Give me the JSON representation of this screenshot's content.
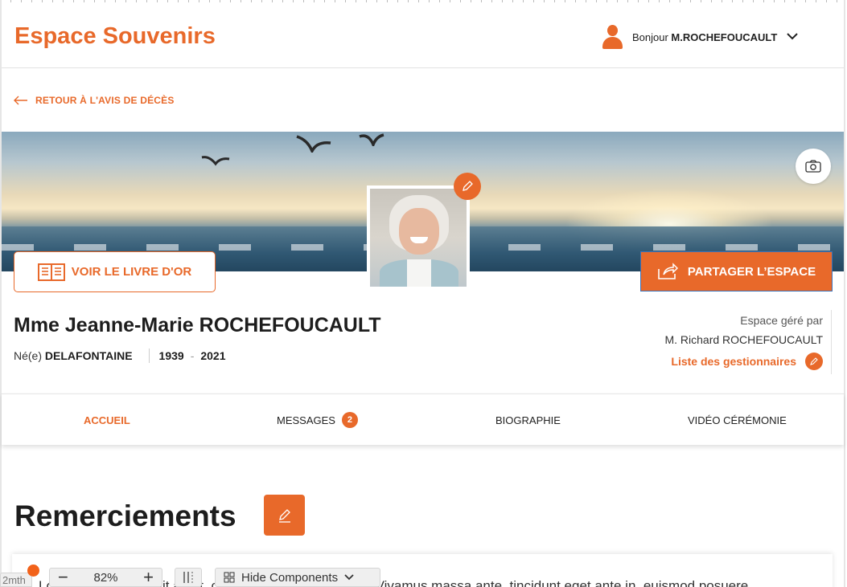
{
  "header": {
    "brand": "Espace Souvenirs",
    "greeting_prefix": "Bonjour ",
    "user_name": "M.ROCHEFOUCAULT"
  },
  "back_link": "RETOUR À L'AVIS DE DÉCÈS",
  "banner": {
    "livre_button": "VOIR LE LIVRE D'OR",
    "share_button": "PARTAGER L’ESPACE"
  },
  "person": {
    "name": "Mme Jeanne-Marie ROCHEFOUCAULT",
    "born_prefix": "Né(e)",
    "maiden_name": "DELAFONTAINE",
    "year_birth": "1939",
    "year_death": "2021",
    "dash": "-"
  },
  "managed": {
    "label": "Espace géré par",
    "manager": "M. Richard ROCHEFOUCAULT",
    "list_link": "Liste des gestionnaires"
  },
  "tabs": [
    {
      "label": "ACCUEIL",
      "active": true
    },
    {
      "label": "MESSAGES",
      "badge": "2"
    },
    {
      "label": "BIOGRAPHIE"
    },
    {
      "label": "VIDÉO CÉRÉMONIE"
    }
  ],
  "section": {
    "title": "Remerciements",
    "text": "Lorem ipsum dolor sit amet, consectetur adipiscing elit. Vivamus massa ante, tincidunt eget ante in, euismod posuere"
  },
  "toolbar": {
    "tab_label": "2mth",
    "zoom": "82%",
    "minus": "−",
    "plus": "+",
    "hide_components": "Hide Components"
  },
  "colors": {
    "accent": "#e8692a",
    "text": "#222222"
  },
  "icons": [
    "user-icon",
    "chevron-down-icon",
    "arrow-left-icon",
    "camera-icon",
    "pencil-icon",
    "book-icon",
    "share-icon",
    "ruler-icon",
    "grid-icon"
  ]
}
